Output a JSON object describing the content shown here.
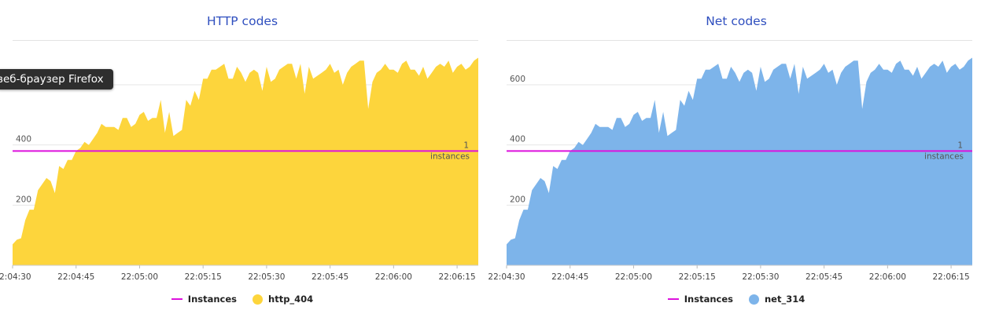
{
  "tooltip": {
    "text": "веб-браузер Firefox"
  },
  "colors": {
    "instances": "#dd11dd",
    "http_404": "#fdd53c",
    "net_314": "#7db4ea",
    "title": "#2f4fbf"
  },
  "chart_data": [
    {
      "type": "area",
      "title": "HTTP codes",
      "x_ticks": [
        "22:04:30",
        "22:04:45",
        "22:05:00",
        "22:05:15",
        "22:05:30",
        "22:05:45",
        "22:06:00",
        "22:06:15"
      ],
      "y_ticks": [
        200,
        400,
        600
      ],
      "ylim": [
        0,
        720
      ],
      "xlim": [
        "22:04:30",
        "22:06:20"
      ],
      "annotation": {
        "value": "1",
        "label": "instances"
      },
      "series": [
        {
          "name": "http_404",
          "type": "area",
          "x": [
            "22:04:30",
            "22:04:31",
            "22:04:32",
            "22:04:33",
            "22:04:34",
            "22:04:35",
            "22:04:36",
            "22:04:37",
            "22:04:38",
            "22:04:39",
            "22:04:40",
            "22:04:41",
            "22:04:42",
            "22:04:43",
            "22:04:44",
            "22:04:45",
            "22:04:46",
            "22:04:47",
            "22:04:48",
            "22:04:49",
            "22:04:50",
            "22:04:51",
            "22:04:52",
            "22:04:53",
            "22:04:54",
            "22:04:55",
            "22:04:56",
            "22:04:57",
            "22:04:58",
            "22:04:59",
            "22:05:00",
            "22:05:01",
            "22:05:02",
            "22:05:03",
            "22:05:04",
            "22:05:05",
            "22:05:06",
            "22:05:07",
            "22:05:08",
            "22:05:09",
            "22:05:10",
            "22:05:11",
            "22:05:12",
            "22:05:13",
            "22:05:14",
            "22:05:15",
            "22:05:16",
            "22:05:17",
            "22:05:18",
            "22:05:19",
            "22:05:20",
            "22:05:21",
            "22:05:22",
            "22:05:23",
            "22:05:24",
            "22:05:25",
            "22:05:26",
            "22:05:27",
            "22:05:28",
            "22:05:29",
            "22:05:30",
            "22:05:31",
            "22:05:32",
            "22:05:33",
            "22:05:34",
            "22:05:35",
            "22:05:36",
            "22:05:37",
            "22:05:38",
            "22:05:39",
            "22:05:40",
            "22:05:41",
            "22:05:42",
            "22:05:43",
            "22:05:44",
            "22:05:45",
            "22:05:46",
            "22:05:47",
            "22:05:48",
            "22:05:49",
            "22:05:50",
            "22:05:51",
            "22:05:52",
            "22:05:53",
            "22:05:54",
            "22:05:55",
            "22:05:56",
            "22:05:57",
            "22:05:58",
            "22:05:59",
            "22:06:00",
            "22:06:01",
            "22:06:02",
            "22:06:03",
            "22:06:04",
            "22:06:05",
            "22:06:06",
            "22:06:07",
            "22:06:08",
            "22:06:09",
            "22:06:10",
            "22:06:11",
            "22:06:12",
            "22:06:13",
            "22:06:14",
            "22:06:15",
            "22:06:16",
            "22:06:17",
            "22:06:18",
            "22:06:19",
            "22:06:20"
          ],
          "values": [
            70,
            85,
            90,
            150,
            185,
            185,
            250,
            270,
            290,
            280,
            240,
            330,
            320,
            350,
            350,
            380,
            390,
            410,
            400,
            420,
            440,
            470,
            460,
            460,
            460,
            450,
            490,
            490,
            460,
            470,
            500,
            510,
            480,
            490,
            490,
            550,
            440,
            510,
            430,
            440,
            450,
            550,
            530,
            580,
            550,
            620,
            620,
            650,
            650,
            660,
            670,
            620,
            620,
            660,
            640,
            610,
            640,
            650,
            640,
            580,
            660,
            610,
            620,
            650,
            660,
            670,
            670,
            620,
            670,
            570,
            660,
            620,
            630,
            640,
            650,
            670,
            640,
            650,
            600,
            640,
            660,
            670,
            680,
            680,
            520,
            610,
            640,
            650,
            670,
            650,
            650,
            640,
            670,
            680,
            650,
            650,
            630,
            660,
            620,
            640,
            660,
            670,
            660,
            680,
            640,
            660,
            670,
            650,
            660,
            680,
            690
          ]
        },
        {
          "name": "Instances",
          "type": "line",
          "values": [
            380
          ]
        }
      ]
    },
    {
      "type": "area",
      "title": "Net codes",
      "x_ticks": [
        "22:04:30",
        "22:04:45",
        "22:05:00",
        "22:05:15",
        "22:05:30",
        "22:05:45",
        "22:06:00",
        "22:06:15"
      ],
      "y_ticks": [
        200,
        400,
        600
      ],
      "ylim": [
        0,
        720
      ],
      "xlim": [
        "22:04:30",
        "22:06:20"
      ],
      "annotation": {
        "value": "1",
        "label": "instances"
      },
      "series": [
        {
          "name": "net_314",
          "type": "area",
          "x": [
            "22:04:30",
            "22:04:31",
            "22:04:32",
            "22:04:33",
            "22:04:34",
            "22:04:35",
            "22:04:36",
            "22:04:37",
            "22:04:38",
            "22:04:39",
            "22:04:40",
            "22:04:41",
            "22:04:42",
            "22:04:43",
            "22:04:44",
            "22:04:45",
            "22:04:46",
            "22:04:47",
            "22:04:48",
            "22:04:49",
            "22:04:50",
            "22:04:51",
            "22:04:52",
            "22:04:53",
            "22:04:54",
            "22:04:55",
            "22:04:56",
            "22:04:57",
            "22:04:58",
            "22:04:59",
            "22:05:00",
            "22:05:01",
            "22:05:02",
            "22:05:03",
            "22:05:04",
            "22:05:05",
            "22:05:06",
            "22:05:07",
            "22:05:08",
            "22:05:09",
            "22:05:10",
            "22:05:11",
            "22:05:12",
            "22:05:13",
            "22:05:14",
            "22:05:15",
            "22:05:16",
            "22:05:17",
            "22:05:18",
            "22:05:19",
            "22:05:20",
            "22:05:21",
            "22:05:22",
            "22:05:23",
            "22:05:24",
            "22:05:25",
            "22:05:26",
            "22:05:27",
            "22:05:28",
            "22:05:29",
            "22:05:30",
            "22:05:31",
            "22:05:32",
            "22:05:33",
            "22:05:34",
            "22:05:35",
            "22:05:36",
            "22:05:37",
            "22:05:38",
            "22:05:39",
            "22:05:40",
            "22:05:41",
            "22:05:42",
            "22:05:43",
            "22:05:44",
            "22:05:45",
            "22:05:46",
            "22:05:47",
            "22:05:48",
            "22:05:49",
            "22:05:50",
            "22:05:51",
            "22:05:52",
            "22:05:53",
            "22:05:54",
            "22:05:55",
            "22:05:56",
            "22:05:57",
            "22:05:58",
            "22:05:59",
            "22:06:00",
            "22:06:01",
            "22:06:02",
            "22:06:03",
            "22:06:04",
            "22:06:05",
            "22:06:06",
            "22:06:07",
            "22:06:08",
            "22:06:09",
            "22:06:10",
            "22:06:11",
            "22:06:12",
            "22:06:13",
            "22:06:14",
            "22:06:15",
            "22:06:16",
            "22:06:17",
            "22:06:18",
            "22:06:19",
            "22:06:20"
          ],
          "values": [
            70,
            85,
            90,
            150,
            185,
            185,
            250,
            270,
            290,
            280,
            240,
            330,
            320,
            350,
            350,
            380,
            390,
            410,
            400,
            420,
            440,
            470,
            460,
            460,
            460,
            450,
            490,
            490,
            460,
            470,
            500,
            510,
            480,
            490,
            490,
            550,
            440,
            510,
            430,
            440,
            450,
            550,
            530,
            580,
            550,
            620,
            620,
            650,
            650,
            660,
            670,
            620,
            620,
            660,
            640,
            610,
            640,
            650,
            640,
            580,
            660,
            610,
            620,
            650,
            660,
            670,
            670,
            620,
            670,
            570,
            660,
            620,
            630,
            640,
            650,
            670,
            640,
            650,
            600,
            640,
            660,
            670,
            680,
            680,
            520,
            610,
            640,
            650,
            670,
            650,
            650,
            640,
            670,
            680,
            650,
            650,
            630,
            660,
            620,
            640,
            660,
            670,
            660,
            680,
            640,
            660,
            670,
            650,
            660,
            680,
            690
          ]
        },
        {
          "name": "Instances",
          "type": "line",
          "values": [
            380
          ]
        }
      ]
    }
  ],
  "legends": [
    [
      {
        "label": "Instances",
        "kind": "line",
        "color": "#dd11dd"
      },
      {
        "label": "http_404",
        "kind": "dot",
        "color": "#fdd53c"
      }
    ],
    [
      {
        "label": "Instances",
        "kind": "line",
        "color": "#dd11dd"
      },
      {
        "label": "net_314",
        "kind": "dot",
        "color": "#7db4ea"
      }
    ]
  ]
}
